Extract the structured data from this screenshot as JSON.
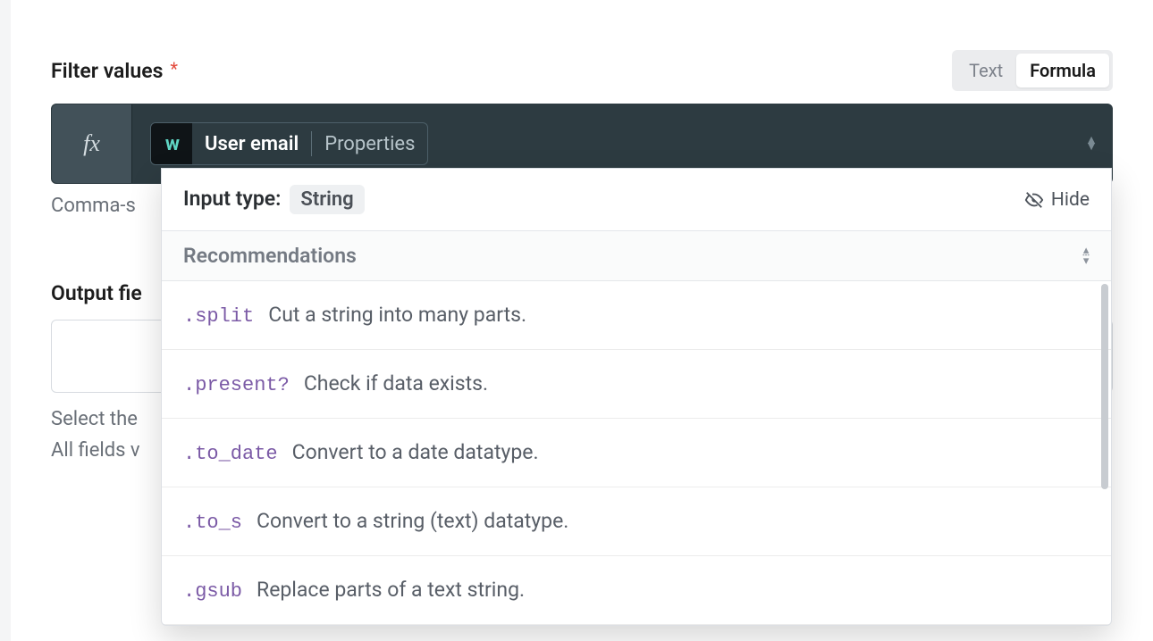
{
  "field": {
    "label": "Filter values",
    "required_marker": "*",
    "helper_text": "Comma-s"
  },
  "toggle": {
    "text": "Text",
    "formula": "Formula"
  },
  "fx_symbol": "fx",
  "pill": {
    "main": "User email",
    "sub": "Properties"
  },
  "output": {
    "heading": "Output fie",
    "help_line1": "Select the",
    "help_line2": "All fields v"
  },
  "dropdown": {
    "input_type_label": "Input type:",
    "input_type_value": "String",
    "hide_label": "Hide",
    "recommendations_label": "Recommendations",
    "items": [
      {
        "method": ".split",
        "desc": "Cut a string into many parts."
      },
      {
        "method": ".present?",
        "desc": "Check if data exists."
      },
      {
        "method": ".to_date",
        "desc": "Convert to a date datatype."
      },
      {
        "method": ".to_s",
        "desc": "Convert to a string (text) datatype."
      },
      {
        "method": ".gsub",
        "desc": "Replace parts of a text string."
      }
    ]
  }
}
